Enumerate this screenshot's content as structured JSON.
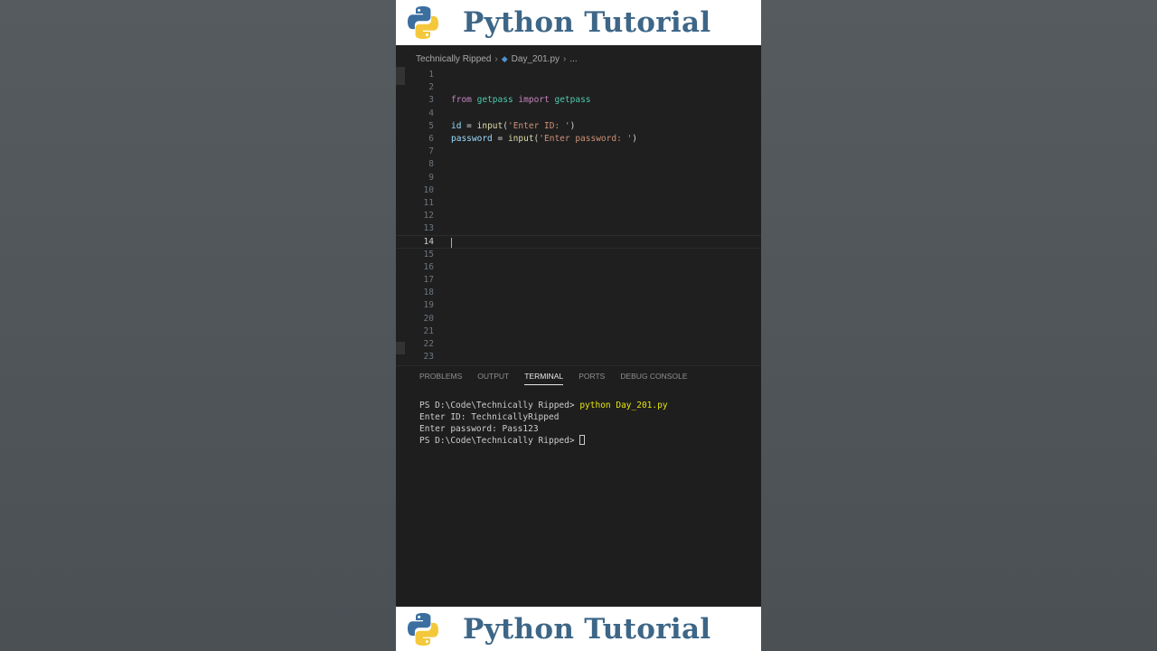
{
  "banner": {
    "title": "Python Tutorial"
  },
  "editor": {
    "breadcrumb": {
      "folder": "Technically Ripped",
      "file": "Day_201.py",
      "more": "..."
    },
    "line_numbers": [
      "1",
      "2",
      "3",
      "4",
      "5",
      "6",
      "7",
      "8",
      "9",
      "10",
      "11",
      "12",
      "13",
      "14",
      "15",
      "16",
      "17",
      "18",
      "19",
      "20",
      "21",
      "22",
      "23"
    ],
    "code": {
      "line3": {
        "from": "from",
        "module": "getpass",
        "import": "import",
        "name": "getpass"
      },
      "line5": {
        "var": "id",
        "eq": " = ",
        "fn": "input",
        "open": "(",
        "str": "'Enter ID: '",
        "close": ")"
      },
      "line6": {
        "var": "password",
        "eq": " = ",
        "fn": "input",
        "open": "(",
        "str": "'Enter password: '",
        "close": ")"
      }
    },
    "active_line": "14"
  },
  "panel": {
    "tabs": [
      "PROBLEMS",
      "OUTPUT",
      "TERMINAL",
      "PORTS",
      "DEBUG CONSOLE"
    ],
    "active_tab": "TERMINAL",
    "terminal": {
      "prompt1": "PS D:\\Code\\Technically Ripped> ",
      "command": "python Day_201.py",
      "out1": "Enter ID: TechnicallyRipped",
      "out2": "Enter password: Pass123",
      "prompt2": "PS D:\\Code\\Technically Ripped> "
    }
  },
  "colors": {
    "banner_title": "#3d6687",
    "editor_bg": "#1f1f1f",
    "keyword": "#c586c0",
    "function": "#dcdcaa",
    "string": "#ce9178",
    "variable": "#9cdcfe"
  },
  "icons": {
    "banner_logo": "python-logo-icon",
    "file_icon": "python-file-icon"
  }
}
